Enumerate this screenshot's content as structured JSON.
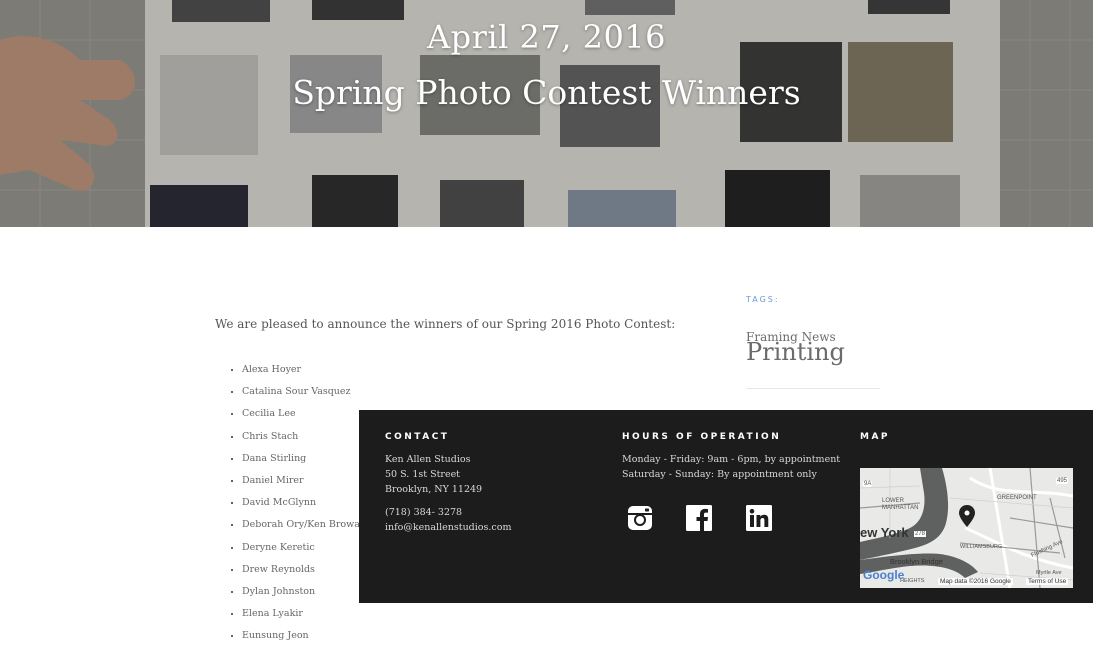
{
  "header": {
    "date": "April 27, 2016",
    "title": "Spring Photo Contest Winners"
  },
  "article": {
    "intro": "We are pleased to announce the winners of our Spring 2016 Photo Contest:",
    "winners": [
      "Alexa Hoyer",
      "Catalina Sour Vasquez",
      "Cecilia Lee",
      "Chris Stach",
      "Dana Stirling",
      "Daniel Mirer",
      "David McGlynn",
      "Deborah Ory/Ken Browar",
      "Deryne Keretic",
      "Drew Reynolds",
      "Dylan Johnston",
      "Elena Lyakir",
      "Eunsung Jeon"
    ]
  },
  "sidebar": {
    "tags_label": "TAGS:",
    "tags": [
      "Framing News",
      "Printing"
    ]
  },
  "footer": {
    "contact": {
      "heading": "CONTACT",
      "name": "Ken Allen Studios",
      "street": "50 S. 1st Street",
      "city": "Brooklyn, NY 11249",
      "phone": "(718) 384- 3278",
      "email": "info@kenallenstudios.com"
    },
    "hours": {
      "heading": "HOURS OF OPERATION",
      "weekday": "Monday - Friday: 9am - 6pm, by appointment",
      "weekend": "Saturday - Sunday: By appointment only"
    },
    "social": [
      "instagram-icon",
      "facebook-icon",
      "linkedin-icon"
    ],
    "map": {
      "heading": "MAP",
      "labels": {
        "lower_manhattan": "LOWER\nMANHATTAN",
        "greenpoint": "GREENPOINT",
        "new_york": "ew York",
        "williamsburg": "WILLIAMSBURG",
        "brooklyn_bridge": "Brooklyn Bridge",
        "flushing": "Flushing Ave",
        "myrtle": "Myrtle Ave",
        "heights": "HEIGHTS",
        "google": "Google",
        "map_data": "Map data ©2016 Google",
        "terms": "Terms of Use",
        "route_9a": "9A",
        "route_495": "495",
        "route_278": "278"
      }
    }
  },
  "colors": {
    "footer_bg": "#1c1c1c",
    "tags_label": "#6a9bd0",
    "map_water": "#5f6060",
    "map_land": "#e9e9e7",
    "pin": "#222222"
  }
}
